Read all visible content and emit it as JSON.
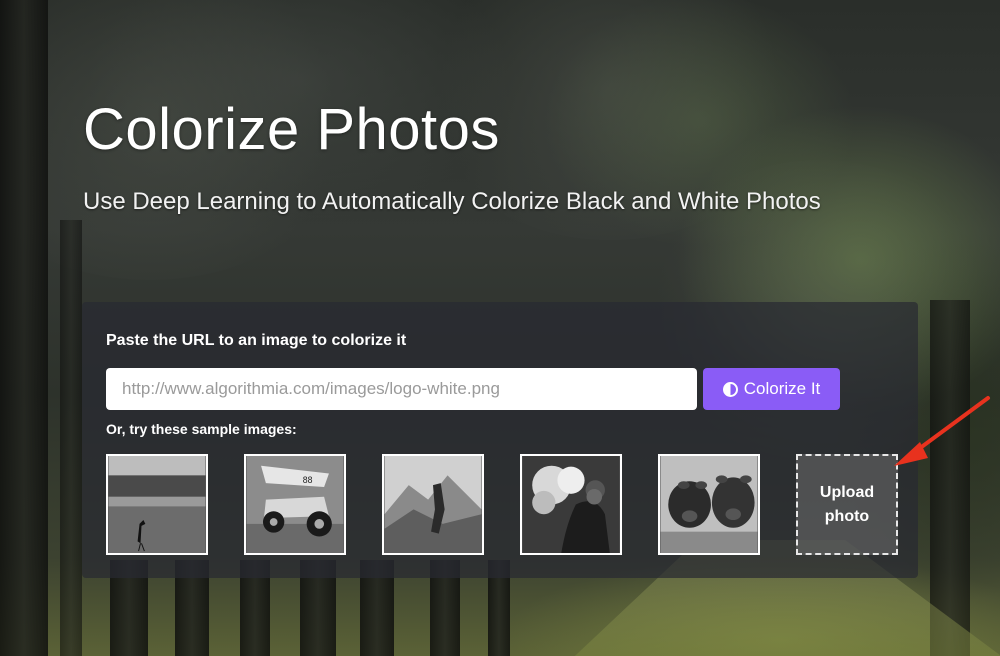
{
  "hero": {
    "title": "Colorize Photos",
    "subtitle": "Use Deep Learning to Automatically Colorize Black and White Photos"
  },
  "form": {
    "label": "Paste the URL to an image to colorize it",
    "url_placeholder": "http://www.algorithmia.com/images/logo-white.png",
    "button_label": "Colorize It",
    "button_icon": "half-circle-icon",
    "button_color": "#8a5cf6"
  },
  "samples": {
    "label": "Or, try these sample images:",
    "items": [
      {
        "subject": "bird-wading-icon"
      },
      {
        "subject": "race-car-icon"
      },
      {
        "subject": "mountain-person-icon"
      },
      {
        "subject": "woman-flowers-icon"
      },
      {
        "subject": "cows-icon"
      }
    ],
    "upload_label_line1": "Upload",
    "upload_label_line2": "photo"
  },
  "annotation": {
    "arrow_color": "#e8321e"
  }
}
